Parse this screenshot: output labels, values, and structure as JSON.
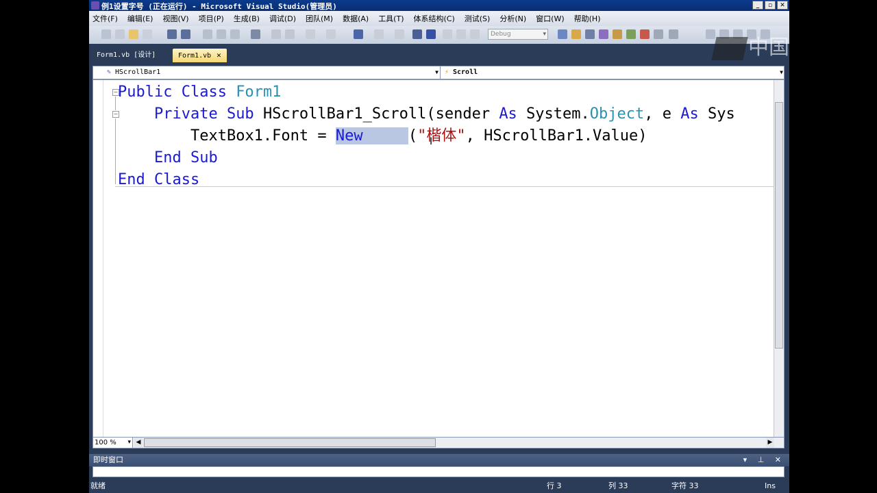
{
  "window": {
    "title": "例1设置字号 (正在运行) - Microsoft Visual Studio(管理员)",
    "controls": [
      "_",
      "▫",
      "✕"
    ]
  },
  "menu": [
    "文件(F)",
    "编辑(E)",
    "视图(V)",
    "项目(P)",
    "生成(B)",
    "调试(D)",
    "团队(M)",
    "数据(A)",
    "工具(T)",
    "体系结构(C)",
    "测试(S)",
    "分析(N)",
    "窗口(W)",
    "帮助(H)"
  ],
  "toolbar": {
    "config": "Debug"
  },
  "tabs": [
    {
      "label": "Form1.vb [设计]",
      "active": false
    },
    {
      "label": "Form1.vb",
      "active": true,
      "close": "✕"
    }
  ],
  "dropdowns": {
    "object": "HScrollBar1",
    "event": "Scroll"
  },
  "code": {
    "l1_kw": "Public Class ",
    "l1_type": "Form1",
    "l2_kw1": "Private Sub ",
    "l2_name": "HScrollBar1_Scroll(sender ",
    "l2_as1": "As",
    "l2_sys": " System.",
    "l2_obj": "Object",
    "l2_e": ", e ",
    "l2_as2": "As",
    "l2_tail": " Sys",
    "l3_pre": "TextBox1.Font = ",
    "l3_new": "New",
    "l3_gap": "     ",
    "l3_paren": "(",
    "l3_str": "\"楷体\"",
    "l3_rest": ", HScrollBar1.Value)",
    "l4": "End Sub",
    "l5": "End Class"
  },
  "zoom": "100 %",
  "immediate_window": {
    "title": "即时窗口",
    "controls": "▾ ⊥ ✕"
  },
  "status": {
    "ready": "就绪",
    "line": "行 3",
    "col": "列 33",
    "char": "字符 33",
    "mode": "Ins"
  },
  "watermark": "中国"
}
